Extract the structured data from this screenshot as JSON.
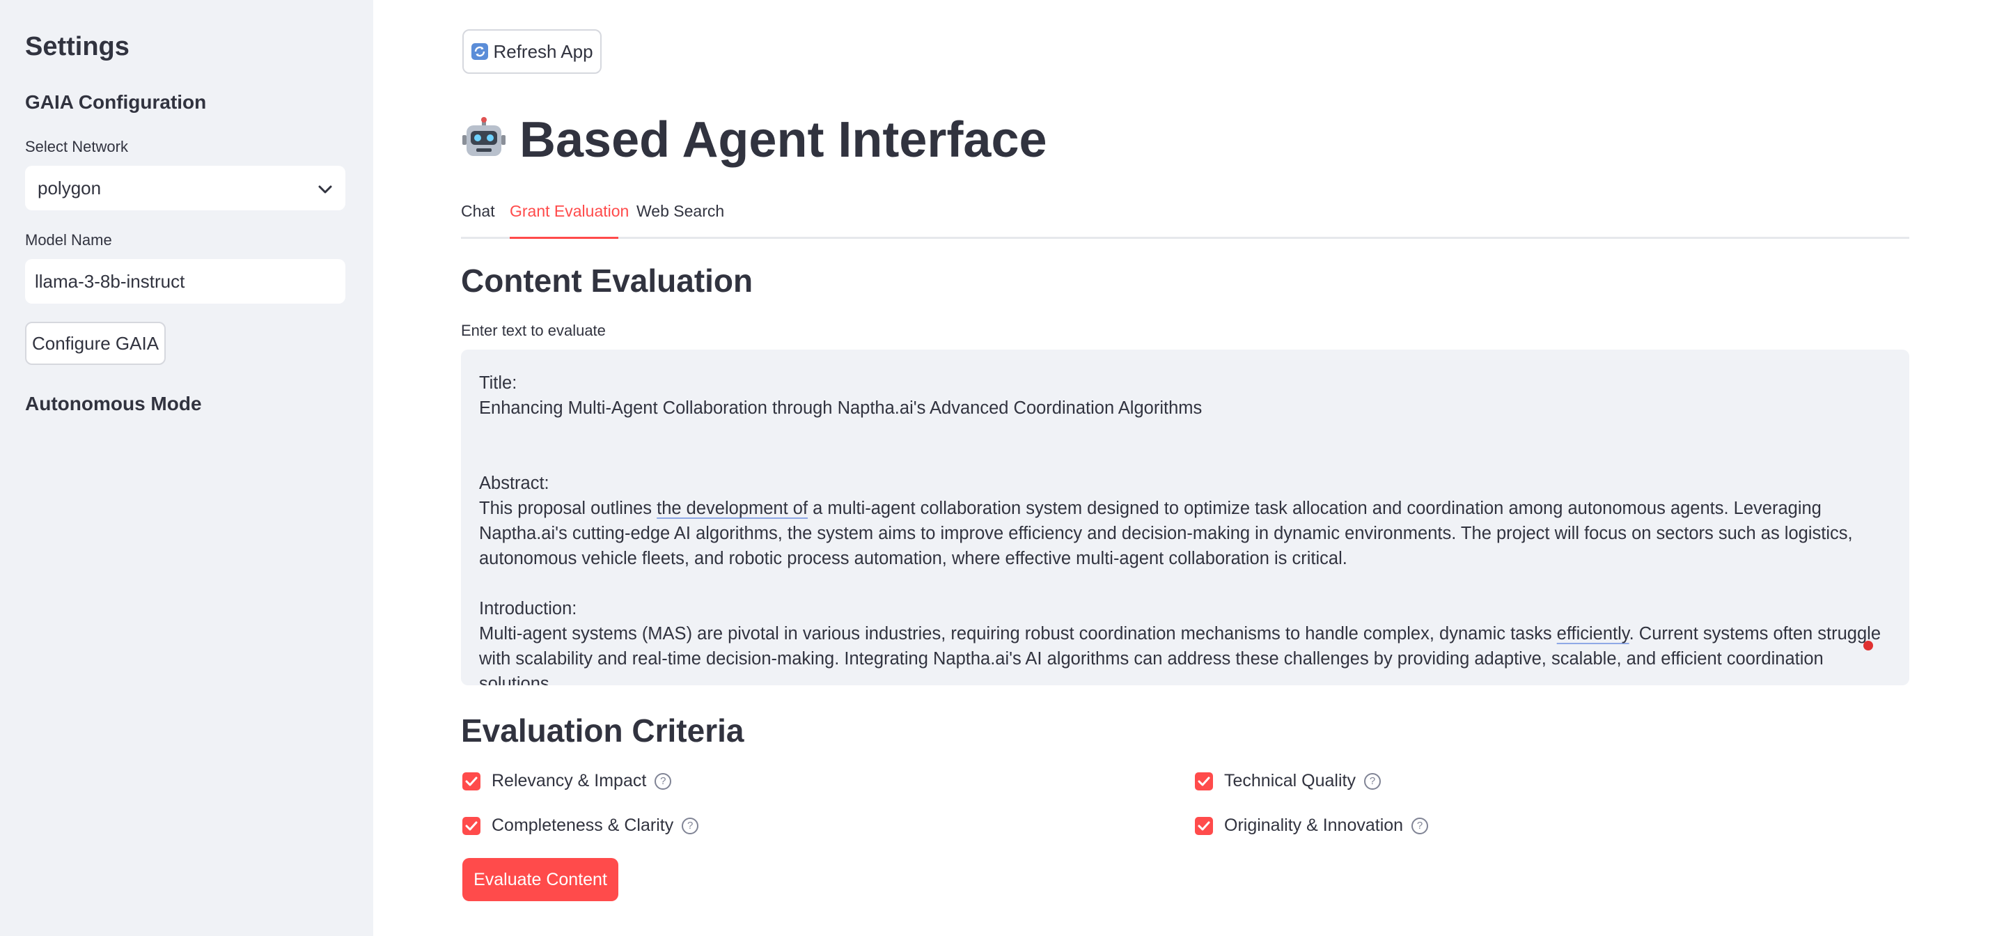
{
  "sidebar": {
    "title": "Settings",
    "section": "GAIA Configuration",
    "network_label": "Select Network",
    "network_value": "polygon",
    "model_label": "Model Name",
    "model_value": "llama-3-8b-instruct",
    "configure_button": "Configure GAIA",
    "autonomous_heading": "Autonomous Mode"
  },
  "main": {
    "refresh_button": "Refresh App",
    "title": "Based Agent Interface",
    "tabs": [
      {
        "label": "Chat",
        "active": false
      },
      {
        "label": "Grant Evaluation",
        "active": true
      },
      {
        "label": "Web Search",
        "active": false
      }
    ],
    "section_title": "Content Evaluation",
    "input_label": "Enter text to evaluate",
    "input_text": {
      "l1": "Title:",
      "l2": "Enhancing Multi-Agent Collaboration through Naptha.ai's Advanced Coordination Algorithms",
      "l3": "Abstract:",
      "l4a": "This proposal outlines ",
      "l4b": "the development of",
      "l4c": " a multi-agent collaboration system designed to optimize task allocation and coordination among autonomous agents. Leveraging Naptha.ai's cutting-edge AI algorithms, the system aims to improve efficiency and decision-making in dynamic environments. The project will focus on sectors such as logistics, autonomous vehicle fleets, and robotic process automation, where effective multi-agent collaboration is critical.",
      "l5": "Introduction:",
      "l6a": "Multi-agent systems (MAS) are pivotal in various industries, requiring robust coordination mechanisms to handle complex, dynamic tasks ",
      "l6b": "efficiently",
      "l6c": ". Current systems often struggle with scalability and real-time decision-making. Integrating Naptha.ai's AI algorithms can address these challenges by providing adaptive, scalable, and efficient coordination solutions."
    },
    "criteria_title": "Evaluation Criteria",
    "criteria": [
      {
        "label": "Relevancy & Impact",
        "checked": true
      },
      {
        "label": "Technical Quality",
        "checked": true
      },
      {
        "label": "Completeness & Clarity",
        "checked": true
      },
      {
        "label": "Originality & Innovation",
        "checked": true
      }
    ],
    "evaluate_button": "Evaluate Content"
  },
  "colors": {
    "accent": "#ff4b4b",
    "sidebar_bg": "#f0f2f6",
    "text": "#31333f"
  }
}
